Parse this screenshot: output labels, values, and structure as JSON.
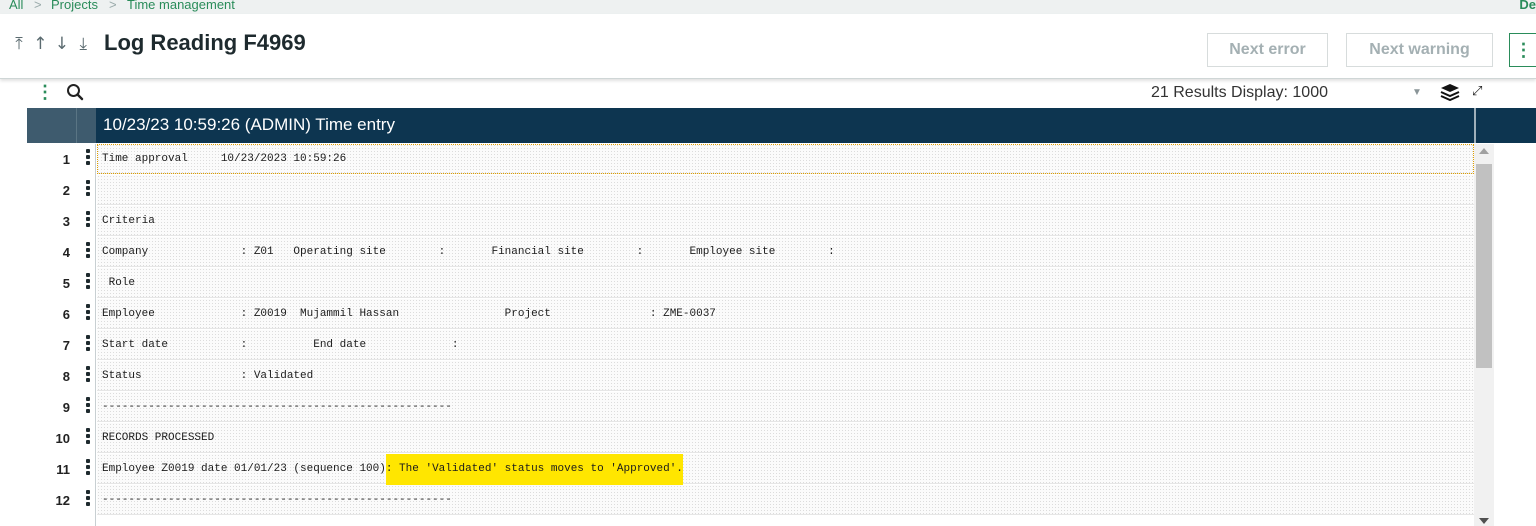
{
  "breadcrumb": {
    "items": [
      "All",
      "Projects",
      "Time management"
    ],
    "separator": ">",
    "right_text": "De"
  },
  "header": {
    "title": "Log Reading F4969",
    "next_error_label": "Next error",
    "next_warning_label": "Next warning",
    "more_label": "⋮"
  },
  "toolbar": {
    "results_text": "21 Results",
    "display_label": "Display:",
    "display_value": "1000"
  },
  "grid": {
    "header_title": "10/23/23 10:59:26 (ADMIN) Time entry",
    "rows": [
      {
        "num": "1",
        "text": "Time approval     10/23/2023 10:59:26"
      },
      {
        "num": "2",
        "text": ""
      },
      {
        "num": "3",
        "text": "Criteria"
      },
      {
        "num": "4",
        "text": "Company              : Z01   Operating site        :       Financial site        :       Employee site        :"
      },
      {
        "num": "5",
        "text": " Role"
      },
      {
        "num": "6",
        "text": "Employee             : Z0019  Mujammil Hassan                Project               : ZME-0037"
      },
      {
        "num": "7",
        "text": "Start date           :          End date             :"
      },
      {
        "num": "8",
        "text": "Status               : Validated"
      },
      {
        "num": "9",
        "text": "-----------------------------------------------------"
      },
      {
        "num": "10",
        "text": "RECORDS PROCESSED"
      },
      {
        "num": "11",
        "text": "Employee Z0019 date 01/01/23 (sequence 100)",
        "highlight": ": The 'Validated' status moves to 'Approved'."
      },
      {
        "num": "12",
        "text": "-----------------------------------------------------"
      }
    ]
  },
  "colors": {
    "accent_green": "#2a8c5a",
    "grid_header": "#0d3550",
    "highlight": "#ffe600"
  }
}
